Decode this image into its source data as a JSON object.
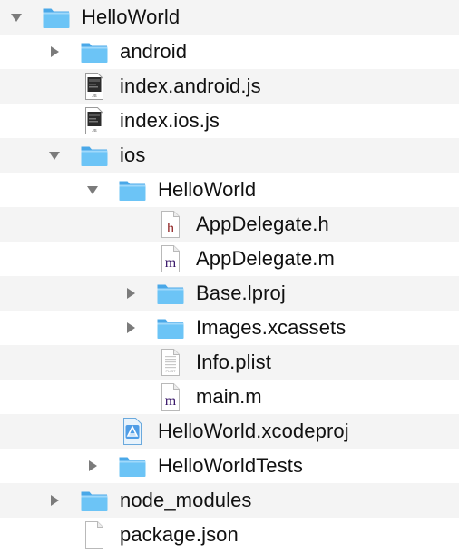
{
  "tree": {
    "items": [
      {
        "label": "HelloWorld",
        "kind": "folder",
        "state": "expanded",
        "depth": 0
      },
      {
        "label": "android",
        "kind": "folder",
        "state": "collapsed",
        "depth": 1
      },
      {
        "label": "index.android.js",
        "kind": "js-file",
        "depth": 1
      },
      {
        "label": "index.ios.js",
        "kind": "js-file",
        "depth": 1
      },
      {
        "label": "ios",
        "kind": "folder",
        "state": "expanded",
        "depth": 1
      },
      {
        "label": "HelloWorld",
        "kind": "folder",
        "state": "expanded",
        "depth": 2
      },
      {
        "label": "AppDelegate.h",
        "kind": "header-file",
        "glyph": "h",
        "depth": 3
      },
      {
        "label": "AppDelegate.m",
        "kind": "objc-file",
        "glyph": "m",
        "depth": 3
      },
      {
        "label": "Base.lproj",
        "kind": "folder",
        "state": "collapsed",
        "depth": 3
      },
      {
        "label": "Images.xcassets",
        "kind": "folder",
        "state": "collapsed",
        "depth": 3
      },
      {
        "label": "Info.plist",
        "kind": "plist-file",
        "glyph": "PLIST",
        "depth": 3
      },
      {
        "label": "main.m",
        "kind": "objc-file",
        "glyph": "m",
        "depth": 3
      },
      {
        "label": "HelloWorld.xcodeproj",
        "kind": "xcodeproj-file",
        "depth": 2
      },
      {
        "label": "HelloWorldTests",
        "kind": "folder",
        "state": "collapsed",
        "depth": 2
      },
      {
        "label": "node_modules",
        "kind": "folder",
        "state": "collapsed",
        "depth": 1
      },
      {
        "label": "package.json",
        "kind": "generic-file",
        "depth": 1
      }
    ]
  },
  "colors": {
    "folder_front": "#6cc4f6",
    "folder_back": "#4aa8e8",
    "stripe": "#f4f4f4",
    "disclosure": "#7b7b7b",
    "header_glyph": "#8b1a1a",
    "objc_glyph": "#3b1a6b"
  }
}
